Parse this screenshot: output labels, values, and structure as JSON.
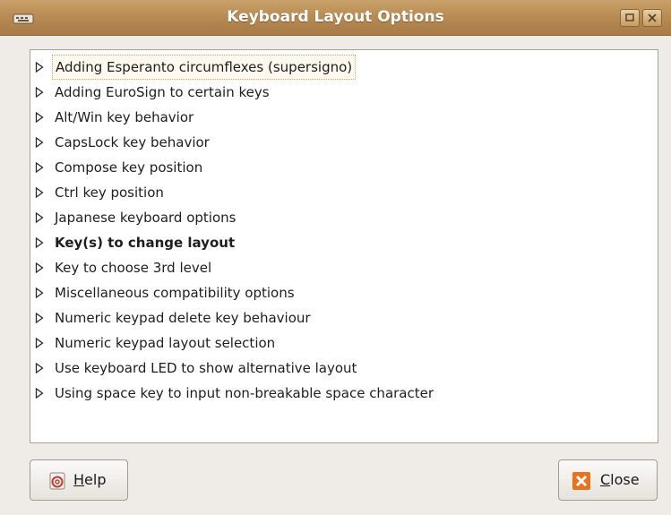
{
  "window": {
    "title": "Keyboard Layout Options",
    "maximize_icon": "maximize-icon",
    "close_icon": "close-icon"
  },
  "tree": {
    "items": [
      {
        "label": "Adding Esperanto circumflexes (supersigno)",
        "state": "focused"
      },
      {
        "label": "Adding EuroSign to certain keys"
      },
      {
        "label": "Alt/Win key behavior"
      },
      {
        "label": "CapsLock key behavior"
      },
      {
        "label": "Compose key position"
      },
      {
        "label": "Ctrl key position"
      },
      {
        "label": "Japanese keyboard options"
      },
      {
        "label": "Key(s) to change layout",
        "state": "bold"
      },
      {
        "label": "Key to choose 3rd level"
      },
      {
        "label": "Miscellaneous compatibility options"
      },
      {
        "label": "Numeric keypad delete key behaviour"
      },
      {
        "label": "Numeric keypad layout selection"
      },
      {
        "label": "Use keyboard LED to show alternative layout"
      },
      {
        "label": "Using space key to input non-breakable space character"
      }
    ]
  },
  "buttons": {
    "help_mnemonic": "H",
    "help_rest": "elp",
    "close_mnemonic": "C",
    "close_rest": "lose"
  },
  "colors": {
    "titlebar": "#b98c55",
    "focus_outline": "#d6a56a",
    "close_icon_bg": "#e8731f"
  }
}
